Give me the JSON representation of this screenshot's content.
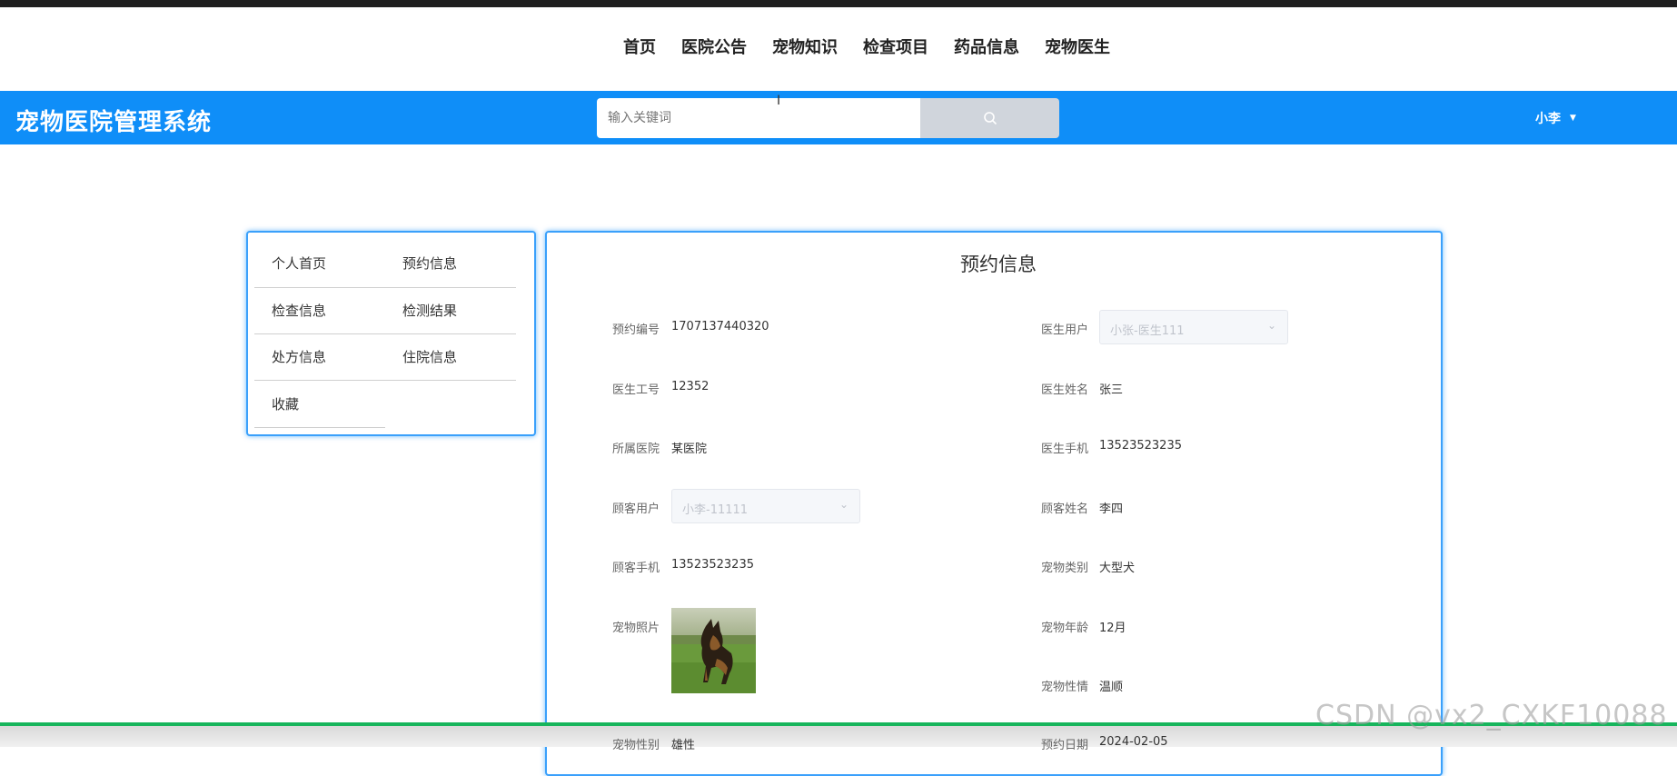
{
  "nav": {
    "items": [
      "首页",
      "医院公告",
      "宠物知识",
      "检查项目",
      "药品信息",
      "宠物医生"
    ]
  },
  "header": {
    "brand": "宠物医院管理系统",
    "search_placeholder": "输入关键词",
    "user_name": "小李",
    "accent_color": "#0f8ef8"
  },
  "sidebar": {
    "items": [
      "个人首页",
      "预约信息",
      "检查信息",
      "检测结果",
      "处方信息",
      "住院信息",
      "收藏"
    ]
  },
  "detail": {
    "title": "预约信息",
    "fields": {
      "appointment_no": {
        "label": "预约编号",
        "value": "1707137440320"
      },
      "doctor_user": {
        "label": "医生用户",
        "value": "小张-医生111"
      },
      "doctor_id": {
        "label": "医生工号",
        "value": "12352"
      },
      "doctor_name": {
        "label": "医生姓名",
        "value": "张三"
      },
      "hospital": {
        "label": "所属医院",
        "value": "某医院"
      },
      "doctor_phone": {
        "label": "医生手机",
        "value": "13523523235"
      },
      "customer_user": {
        "label": "顾客用户",
        "value": "小李-11111"
      },
      "customer_name": {
        "label": "顾客姓名",
        "value": "李四"
      },
      "customer_phone": {
        "label": "顾客手机",
        "value": "13523523235"
      },
      "pet_type": {
        "label": "宠物类别",
        "value": "大型犬"
      },
      "pet_photo": {
        "label": "宠物照片"
      },
      "pet_age": {
        "label": "宠物年龄",
        "value": "12月"
      },
      "pet_temper": {
        "label": "宠物性情",
        "value": "温顺"
      },
      "pet_gender": {
        "label": "宠物性别",
        "value": "雄性"
      },
      "appointment_date": {
        "label": "预约日期",
        "value": "2024-02-05"
      }
    }
  },
  "watermark": "CSDN @vx2_CXKF10088"
}
